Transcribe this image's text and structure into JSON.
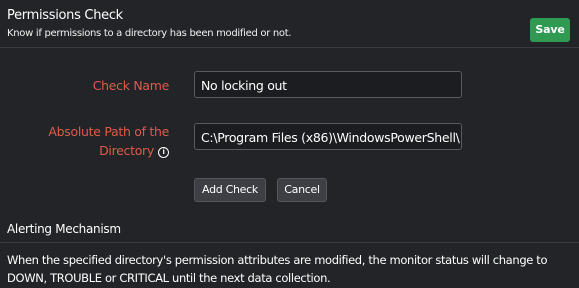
{
  "header": {
    "title": "Permissions Check",
    "subtitle": "Know if permissions to a directory has been modified or not.",
    "save_label": "Save"
  },
  "form": {
    "check_name_label": "Check Name",
    "check_name_value": "No locking out",
    "path_label_line1": "Absolute Path of the",
    "path_label_line2": "Directory",
    "path_info_icon": "info-icon",
    "path_value": "C:\\Program Files (x86)\\WindowsPowerShell\\",
    "add_check_label": "Add Check",
    "cancel_label": "Cancel"
  },
  "alerting": {
    "title": "Alerting Mechanism",
    "description": "When the specified directory's permission attributes are modified, the monitor status will change to DOWN, TROUBLE or CRITICAL until the next data collection."
  },
  "colors": {
    "background": "#232427",
    "label_red": "#e05a4a",
    "save_green": "#2e9a52"
  }
}
